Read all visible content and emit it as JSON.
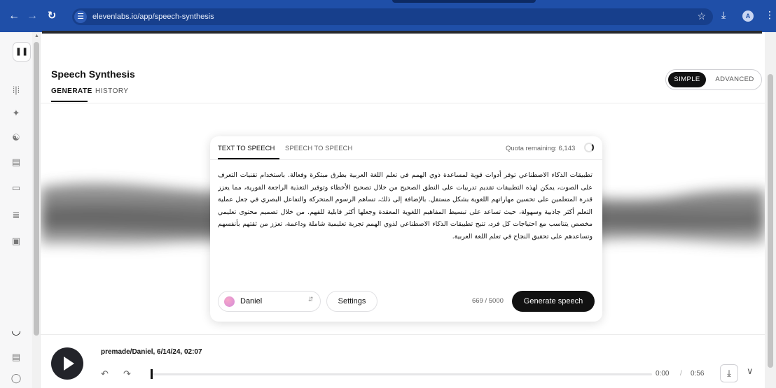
{
  "browser": {
    "url": "elevenlabs.io/app/speech-synthesis",
    "profile_initial": "A"
  },
  "page": {
    "title": "Speech Synthesis",
    "tabs": [
      {
        "label": "GENERATE",
        "active": true
      },
      {
        "label": "HISTORY",
        "active": false
      }
    ],
    "mode": {
      "simple_label": "SIMPLE",
      "advanced_label": "ADVANCED",
      "selected": "simple"
    }
  },
  "card": {
    "tabs": [
      {
        "label": "TEXT TO SPEECH",
        "active": true
      },
      {
        "label": "SPEECH TO SPEECH",
        "active": false
      }
    ],
    "quota_label": "Quota remaining: 6,143",
    "text": "تطبيقات الذكاء الاصطناعي توفر أدوات قوية لمساعدة ذوي الهمم في تعلم اللغة العربية بطرق مبتكرة وفعالة. باستخدام تقنيات التعرف على الصوت، يمكن لهذه التطبيقات تقديم تدريبات على النطق الصحيح من خلال تصحيح الأخطاء وتوفير التغذية الراجعة الفورية، مما يعزز قدرة المتعلمين على تحسين مهاراتهم اللغوية بشكل مستقل. بالإضافة إلى ذلك، تساهم الرسوم المتحركة والتفاعل البصري في جعل عملية التعلم أكثر جاذبية وسهولة، حيث تساعد على تبسيط المفاهيم اللغوية المعقدة وجعلها أكثر قابلية للفهم. من خلال تصميم محتوى تعليمي مخصص يتناسب مع احتياجات كل فرد، تتيح تطبيقات الذكاء الاصطناعي لذوي الهمم تجربة تعليمية شاملة وداعمة، تعزز من ثقتهم بأنفسهم وتساعدهم على تحقيق النجاح في تعلم اللغة العربية.",
    "voice": "Daniel",
    "settings_label": "Settings",
    "char_count": "669 / 5000",
    "generate_label": "Generate speech"
  },
  "player": {
    "track": "premade/Daniel, 6/14/24, 02:07",
    "time_current": "0:00",
    "time_separator": "/",
    "time_total": "0:56",
    "progress_fraction": 0.0
  },
  "icons": {
    "back": "arrow-left-icon",
    "forward": "arrow-right-icon",
    "reload": "reload-icon",
    "site_settings": "tune-icon",
    "bookmark": "star-icon",
    "download": "download-icon",
    "menu": "kebab-icon",
    "sidebar": [
      "pause-icon",
      "waveform-icon",
      "sparkle-icon",
      "users-icon",
      "book-icon",
      "video-icon",
      "translate-icon",
      "scan-icon",
      "loader-icon",
      "panel-icon",
      "shield-icon"
    ]
  },
  "colors": {
    "chrome": "#1f4fa8",
    "primary_button": "#111111",
    "voice_avatar": "#e89bd3"
  }
}
